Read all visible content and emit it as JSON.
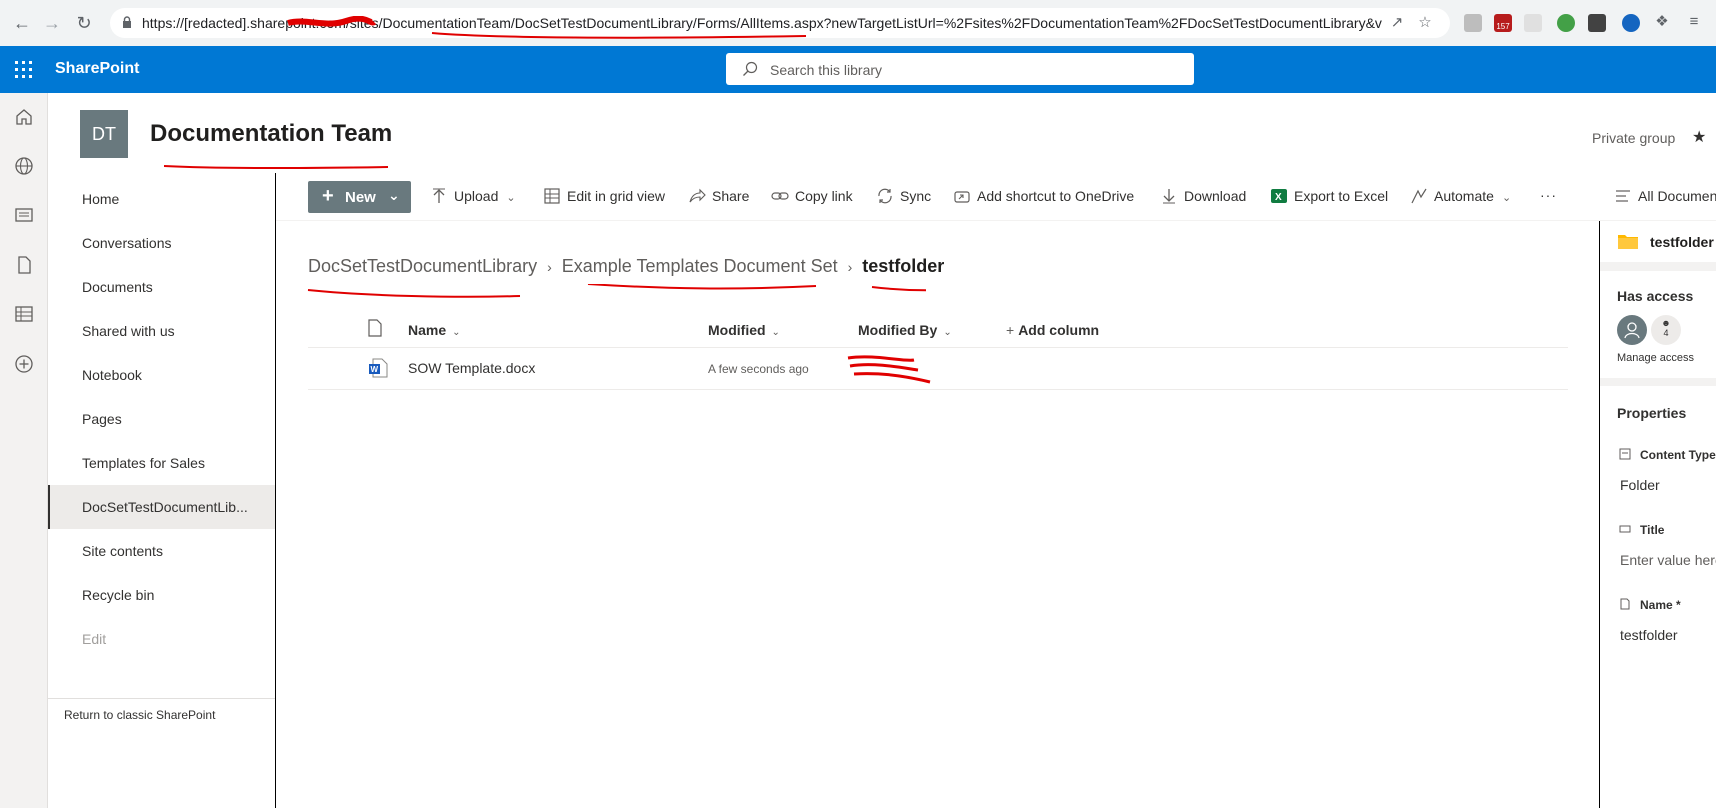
{
  "browser": {
    "url": "https://[redacted].sharepoint.com/sites/DocumentationTeam/DocSetTestDocumentLibrary/Forms/AllItems.aspx?newTargetListUrl=%2Fsites%2FDocumentationTeam%2FDocSetTestDocumentLibrary&v...",
    "extension_badge": "157"
  },
  "suite": {
    "brand": "SharePoint",
    "search_placeholder": "Search this library"
  },
  "site": {
    "logo_initials": "DT",
    "title": "Documentation Team",
    "privacy": "Private group"
  },
  "left_nav": {
    "items": [
      {
        "label": "Home"
      },
      {
        "label": "Conversations"
      },
      {
        "label": "Documents"
      },
      {
        "label": "Shared with us"
      },
      {
        "label": "Notebook"
      },
      {
        "label": "Pages"
      },
      {
        "label": "Templates for Sales"
      },
      {
        "label": "DocSetTestDocumentLib..."
      },
      {
        "label": "Site contents"
      },
      {
        "label": "Recycle bin"
      },
      {
        "label": "Edit"
      }
    ],
    "return_link": "Return to classic SharePoint"
  },
  "command_bar": {
    "new": "New",
    "upload": "Upload",
    "edit_grid": "Edit in grid view",
    "share": "Share",
    "copy_link": "Copy link",
    "sync": "Sync",
    "add_shortcut": "Add shortcut to OneDrive",
    "download": "Download",
    "export_excel": "Export to Excel",
    "automate": "Automate",
    "more": "···",
    "view": "All Documents"
  },
  "breadcrumb": {
    "items": [
      "DocSetTestDocumentLibrary",
      "Example Templates Document Set"
    ],
    "current": "testfolder"
  },
  "list": {
    "columns": {
      "name": "Name",
      "modified": "Modified",
      "modified_by": "Modified By",
      "add_column": "Add column"
    },
    "rows": [
      {
        "name": "SOW Template.docx",
        "modified": "A few seconds ago",
        "modified_by": ""
      }
    ]
  },
  "details_pane": {
    "title": "testfolder",
    "has_access": "Has access",
    "access_count": "4",
    "manage_access": "Manage access",
    "properties": "Properties",
    "content_type_label": "Content Type",
    "content_type_value": "Folder",
    "title_label": "Title",
    "title_placeholder": "Enter value here",
    "name_label": "Name *",
    "name_value": "testfolder"
  },
  "colors": {
    "suite_blue": "#0078d4",
    "new_button": "#69797e",
    "annotation_red": "#e00000"
  }
}
